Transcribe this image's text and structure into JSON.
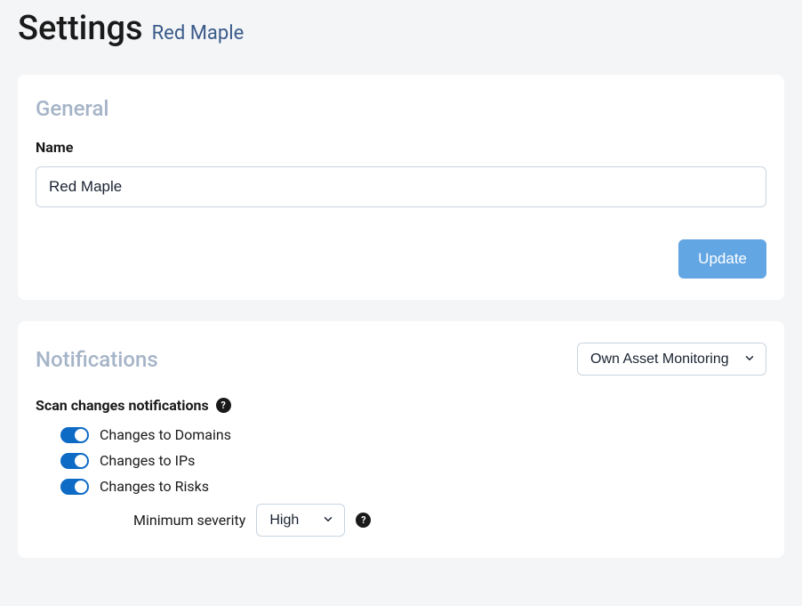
{
  "header": {
    "title": "Settings",
    "subtitle": "Red Maple"
  },
  "general": {
    "section_title": "General",
    "name_label": "Name",
    "name_value": "Red Maple",
    "update_label": "Update"
  },
  "notifications": {
    "section_title": "Notifications",
    "monitoring_select": "Own Asset Monitoring",
    "scan_heading": "Scan changes notifications",
    "toggles": [
      {
        "label": "Changes to Domains",
        "on": true
      },
      {
        "label": "Changes to IPs",
        "on": true
      },
      {
        "label": "Changes to Risks",
        "on": true
      }
    ],
    "severity_label": "Minimum severity",
    "severity_value": "High"
  }
}
